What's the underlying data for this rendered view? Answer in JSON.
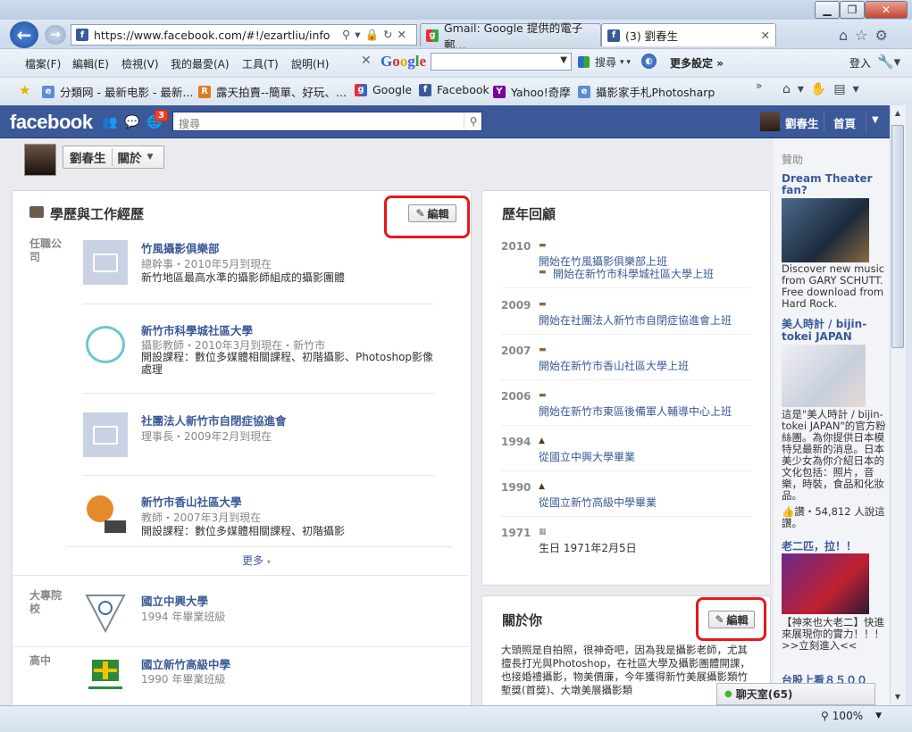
{
  "browser": {
    "url": "https://www.facebook.com/#!/ezartliu/info",
    "tabs": [
      {
        "label": "Gmail: Google 提供的電子郵..."
      },
      {
        "label": "(3) 劉春生"
      }
    ],
    "menu": [
      "檔案(F)",
      "編輯(E)",
      "檢視(V)",
      "我的最愛(A)",
      "工具(T)",
      "說明(H)"
    ],
    "toolbar": {
      "google_label": "Google",
      "search_label": "搜尋",
      "more_settings": "更多設定",
      "login": "登入"
    },
    "favorites": [
      "分類网 - 最新电影 - 最新...",
      "露天拍賣--簡單、好玩、...",
      "Google",
      "Facebook",
      "Yahoo!奇摩",
      "攝影家手札Photosharp"
    ],
    "status_zoom": "100%"
  },
  "fb": {
    "logo": "facebook",
    "notif_count": "3",
    "search_placeholder": "搜尋",
    "user_name": "劉春生",
    "home": "首頁",
    "profile_name": "劉春生",
    "profile_section": "關於"
  },
  "work_edu": {
    "title": "學歷與工作經歷",
    "edit": "編輯",
    "employer_label": "任職公司",
    "employers": [
      {
        "name": "竹風攝影俱樂部",
        "meta": "總幹事・2010年5月到現在",
        "desc": "新竹地區最高水準的攝影師組成的攝影團體"
      },
      {
        "name": "新竹市科學城社區大學",
        "meta": "攝影教師・2010年3月到現在・新竹市",
        "desc": "開設課程：數位多媒體相關課程、初階攝影、Photoshop影像處理"
      },
      {
        "name": "社團法人新竹市自閉症協進會",
        "meta": "理事長・2009年2月到現在",
        "desc": ""
      },
      {
        "name": "新竹市香山社區大學",
        "meta": "教師・2007年3月到現在",
        "desc": "開設課程：數位多媒體相關課程、初階攝影"
      }
    ],
    "more": "更多",
    "college_label": "大專院校",
    "college": {
      "name": "國立中興大學",
      "meta": "1994 年畢業班級"
    },
    "hs_label": "高中",
    "hs": {
      "name": "國立新竹高級中學",
      "meta": "1990 年畢業班級"
    }
  },
  "timeline": {
    "title": "歷年回顧",
    "years": [
      {
        "year": "2010",
        "events": [
          "開始在竹風攝影俱樂部上班",
          "開始在新竹市科學城社區大學上班"
        ]
      },
      {
        "year": "2009",
        "events": [
          "開始在社團法人新竹市自閉症協進會上班"
        ]
      },
      {
        "year": "2007",
        "events": [
          "開始在新竹市香山社區大學上班"
        ]
      },
      {
        "year": "2006",
        "events": [
          "開始在新竹市東區後備軍人輔導中心上班"
        ]
      },
      {
        "year": "1994",
        "events": [
          "從國立中興大學畢業"
        ]
      },
      {
        "year": "1990",
        "events": [
          "從國立新竹高級中學畢業"
        ]
      },
      {
        "year": "1971",
        "events": [
          "生日 1971年2月5日"
        ]
      }
    ]
  },
  "about": {
    "title": "關於你",
    "edit": "編輯",
    "text": "大頭照是自拍照，很神奇吧，因為我是攝影老師，尤其擅長打光與Photoshop，在社區大學及攝影團體開課，也接婚禮攝影，物美價廉，今年獲得新竹美展攝影類竹塹獎(首獎)、大墩美展攝影類"
  },
  "ads": {
    "header": "贊助",
    "items": [
      {
        "title": "Dream Theater fan?",
        "text": "Discover new music from GARY SCHUTT. Free download from Hard Rock."
      },
      {
        "title": "美人時計 / bijin-tokei JAPAN",
        "text": "這是\"美人時計 / bijin-tokei JAPAN\"的官方粉絲團。為你提供日本模特兒最新的消息。日本美少女為你介紹日本的文化包括：照片，音樂，時裝，食品和化妝品。",
        "likes": "讚・54,812 人說這讚。"
      },
      {
        "title": "老二匹，拉！！",
        "text": "【神來也大老二】快進來展現你的實力！！！>>立刻進入<<"
      },
      {
        "title": "台股上看８５００"
      }
    ]
  },
  "chat": {
    "label": "聊天室(65)"
  }
}
